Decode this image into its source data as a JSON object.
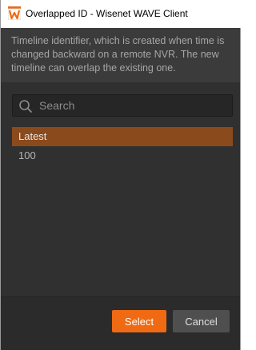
{
  "window": {
    "title": "Overlapped ID - Wisenet WAVE Client",
    "icon": "wisenet-wave-app-icon"
  },
  "description": "Timeline identifier, which is created when time is changed backward on a remote NVR. The new timeline can overlap the existing one.",
  "search": {
    "placeholder": "Search",
    "value": "",
    "icon": "search-icon"
  },
  "list": {
    "items": [
      {
        "label": "Latest",
        "selected": true
      },
      {
        "label": "100",
        "selected": false
      }
    ]
  },
  "buttons": {
    "select_label": "Select",
    "cancel_label": "Cancel"
  },
  "colors": {
    "accent": "#f06a13",
    "selection": "#8b4a1c",
    "background": "#303030"
  }
}
